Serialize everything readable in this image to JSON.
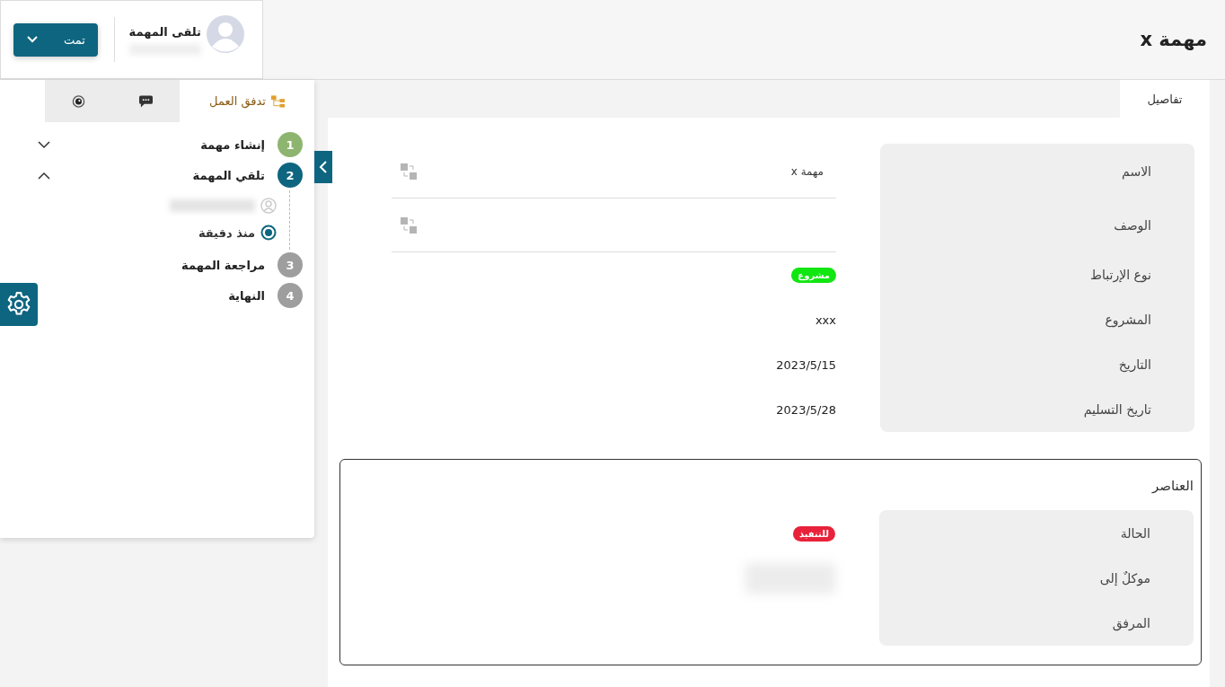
{
  "header": {
    "title": "مهمة x",
    "stage_label": "تلقى المهمة",
    "status_button": "تمت"
  },
  "workflow_tabs": [
    {
      "kind": "workflow",
      "label": "تدفق العمل",
      "selected": true
    },
    {
      "kind": "chat",
      "selected": false
    },
    {
      "kind": "watch",
      "selected": false
    }
  ],
  "steps": [
    {
      "number": "1",
      "label": "إنشاء مهمة",
      "color": "#8db56f",
      "expanded": false
    },
    {
      "number": "2",
      "label": "تلقي المهمة",
      "color": "#0e6580",
      "expanded": true,
      "time": "منذ دقيقة"
    },
    {
      "number": "3",
      "label": "مراجعة المهمة",
      "color": "#9e9e9e"
    },
    {
      "number": "4",
      "label": "النهاية",
      "color": "#9e9e9e"
    }
  ],
  "tabs": [
    {
      "label": "تفاصيل",
      "selected": true
    }
  ],
  "details": [
    {
      "kind": "field",
      "label": "الاسم",
      "value": "مهمة x"
    },
    {
      "kind": "field",
      "label": "الوصف"
    },
    {
      "kind": "badge",
      "label": "نوع الإرتباط",
      "value": "مشروع",
      "color": "#11e611"
    },
    {
      "kind": "text",
      "label": "المشروع",
      "value": "xxx"
    },
    {
      "kind": "text",
      "label": "التاريخ",
      "value": "2023/5/15"
    },
    {
      "kind": "text",
      "label": "تاريخ التسليم",
      "value": "2023/5/28"
    }
  ],
  "elements": {
    "title": "العناصر",
    "items": [
      {
        "kind": "badge",
        "label": "الحالة",
        "value": "للتنفيذ",
        "color": "#e8223a"
      },
      {
        "kind": "hidden",
        "label": "موكلٌ إلى"
      },
      {
        "kind": "text",
        "label": "المرفق"
      }
    ]
  }
}
